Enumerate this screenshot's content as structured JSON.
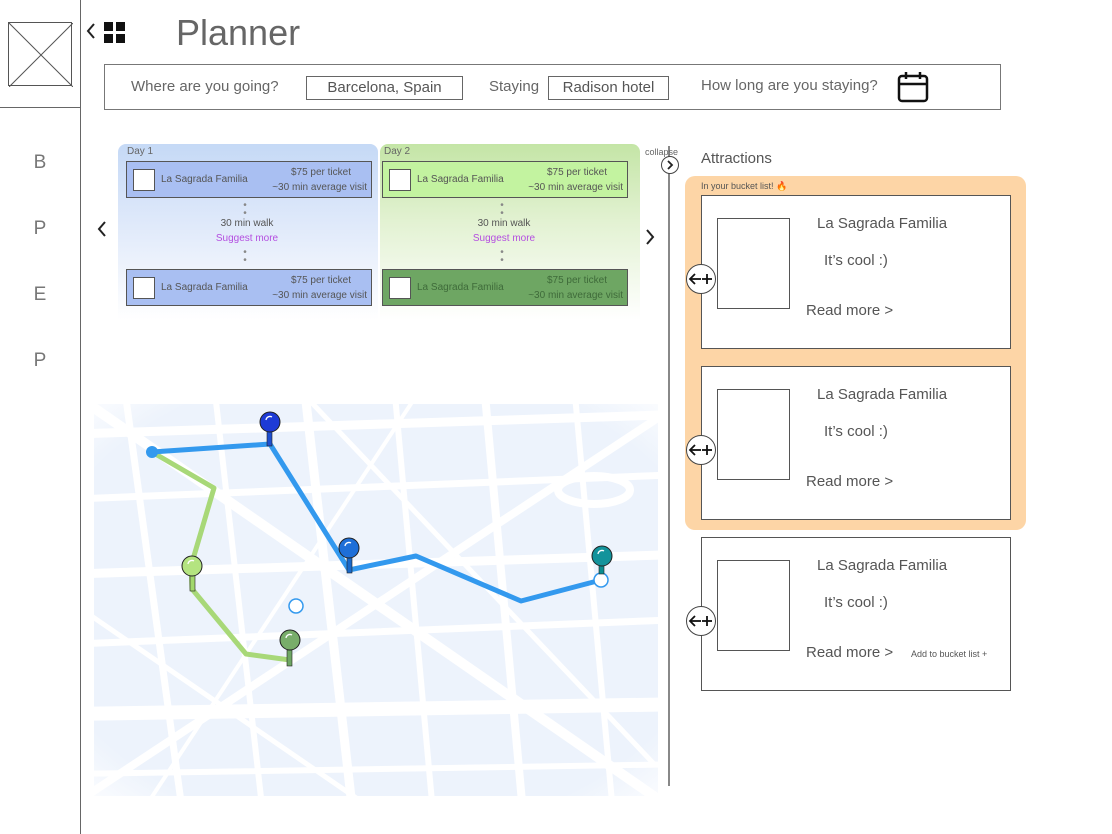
{
  "sidebar": {
    "items": [
      {
        "label": "B"
      },
      {
        "label": "P"
      },
      {
        "label": "E"
      },
      {
        "label": "P"
      }
    ]
  },
  "header": {
    "back_icon": "chevron-left-icon",
    "menu_icon": "grid-icon",
    "title": "Planner"
  },
  "search": {
    "destination_label": "Where are you going?",
    "destination_value": "Barcelona, Spain",
    "staying_label": "Staying",
    "staying_value": "Radison hotel",
    "duration_label": "How long are you staying?",
    "duration_icon": "calendar-icon"
  },
  "itinerary": {
    "days": [
      {
        "label": "Day 1",
        "color": "#c5d9f6",
        "stops": [
          {
            "name": "La Sagrada Familia",
            "price": "$75 per ticket",
            "visit": "~30 min average visit"
          },
          {
            "name": "La Sagrada Familia",
            "price": "$75 per ticket",
            "visit": "~30 min average visit"
          }
        ],
        "walk": "30 min walk",
        "suggest": "Suggest more"
      },
      {
        "label": "Day 2",
        "color": "#c4e5a6",
        "stops": [
          {
            "name": "La Sagrada Familia",
            "price": "$75 per ticket",
            "visit": "~30 min average visit"
          },
          {
            "name": "La Sagrada Familia",
            "price": "$75 per ticket",
            "visit": "~30 min average visit"
          }
        ],
        "walk": "30 min walk",
        "suggest": "Suggest more"
      }
    ],
    "collapse_label": "collapse",
    "prev_icon": "chevron-left-icon",
    "next_icon": "chevron-right-icon"
  },
  "attractions": {
    "title": "Attractions",
    "bucket_label": "In your bucket list! 🔥",
    "bucket_color": "#fdd5a6",
    "items": [
      {
        "name": "La Sagrada Familia",
        "desc": "It’s cool :)",
        "more": "Read more >",
        "add": ""
      },
      {
        "name": "La Sagrada Familia",
        "desc": "It’s cool :)",
        "more": "Read more >",
        "add": ""
      },
      {
        "name": "La Sagrada Familia",
        "desc": "It’s cool :)",
        "more": "Read more >",
        "add": "Add to bucket list +"
      }
    ]
  },
  "colors": {
    "route_blue": "#3399ee",
    "route_green": "#a8d878",
    "day1_card": "#a9bff2",
    "day2_card": "#c3f3a0",
    "day2_card_dim": "#6ea663"
  }
}
